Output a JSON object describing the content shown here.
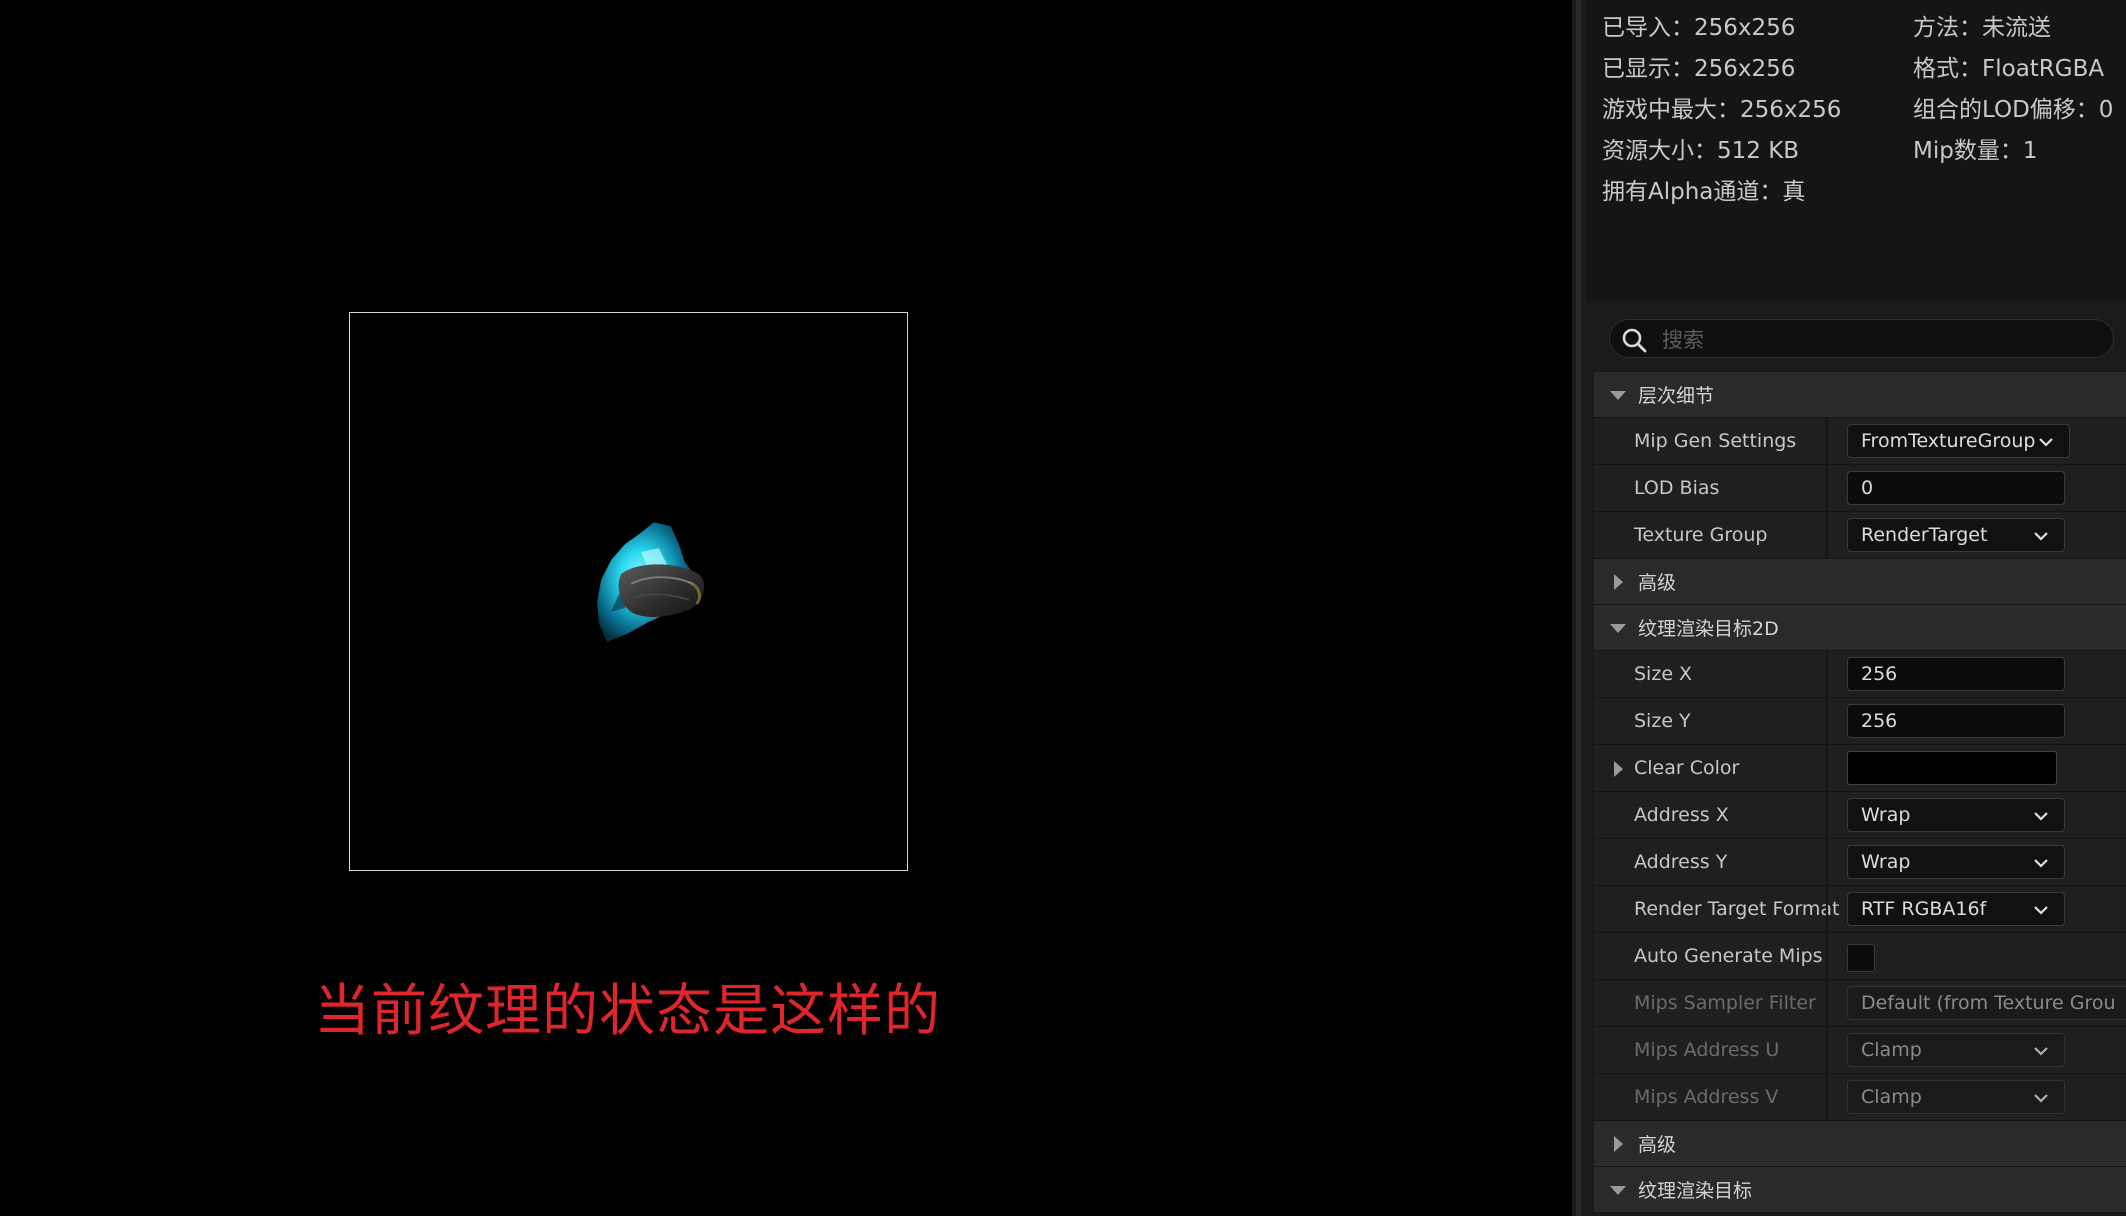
{
  "caption": "当前纹理的状态是这样的",
  "info": {
    "imported": "已导入：256x256",
    "displayed": "已显示：256x256",
    "max_in_game": "游戏中最大：256x256",
    "resource_size": "资源大小：512 KB",
    "has_alpha": "拥有Alpha通道：真",
    "method": "方法：未流送",
    "format": "格式：FloatRGBA",
    "combined_lod": "组合的LOD偏移：0",
    "mip_count": "Mip数量：1"
  },
  "search": {
    "placeholder": "搜索",
    "value": ""
  },
  "sections": {
    "lod": "层次细节",
    "advanced1": "高级",
    "rt2d": "纹理渲染目标2D",
    "advanced2": "高级",
    "rt": "纹理渲染目标"
  },
  "props": {
    "mip_gen": {
      "label": "Mip Gen Settings",
      "value": "FromTextureGroup"
    },
    "lod_bias": {
      "label": "LOD Bias",
      "value": "0"
    },
    "texture_group": {
      "label": "Texture Group",
      "value": "RenderTarget"
    },
    "size_x": {
      "label": "Size X",
      "value": "256"
    },
    "size_y": {
      "label": "Size Y",
      "value": "256"
    },
    "clear_color": {
      "label": "Clear Color",
      "value": "#000000"
    },
    "address_x": {
      "label": "Address X",
      "value": "Wrap"
    },
    "address_y": {
      "label": "Address Y",
      "value": "Wrap"
    },
    "rt_format": {
      "label": "Render Target Format",
      "value": "RTF RGBA16f"
    },
    "auto_mips": {
      "label": "Auto Generate Mips",
      "checked": false
    },
    "mips_filter": {
      "label": "Mips Sampler Filter",
      "value": "Default (from Texture Grou"
    },
    "mips_addr_u": {
      "label": "Mips Address U",
      "value": "Clamp"
    },
    "mips_addr_v": {
      "label": "Mips Address V",
      "value": "Clamp"
    }
  },
  "colors": {
    "caption": "#e0252b",
    "panel_bg": "#1a1a1a",
    "section_bg": "#2a2a2a",
    "texture_glow": "#28d8f0"
  }
}
